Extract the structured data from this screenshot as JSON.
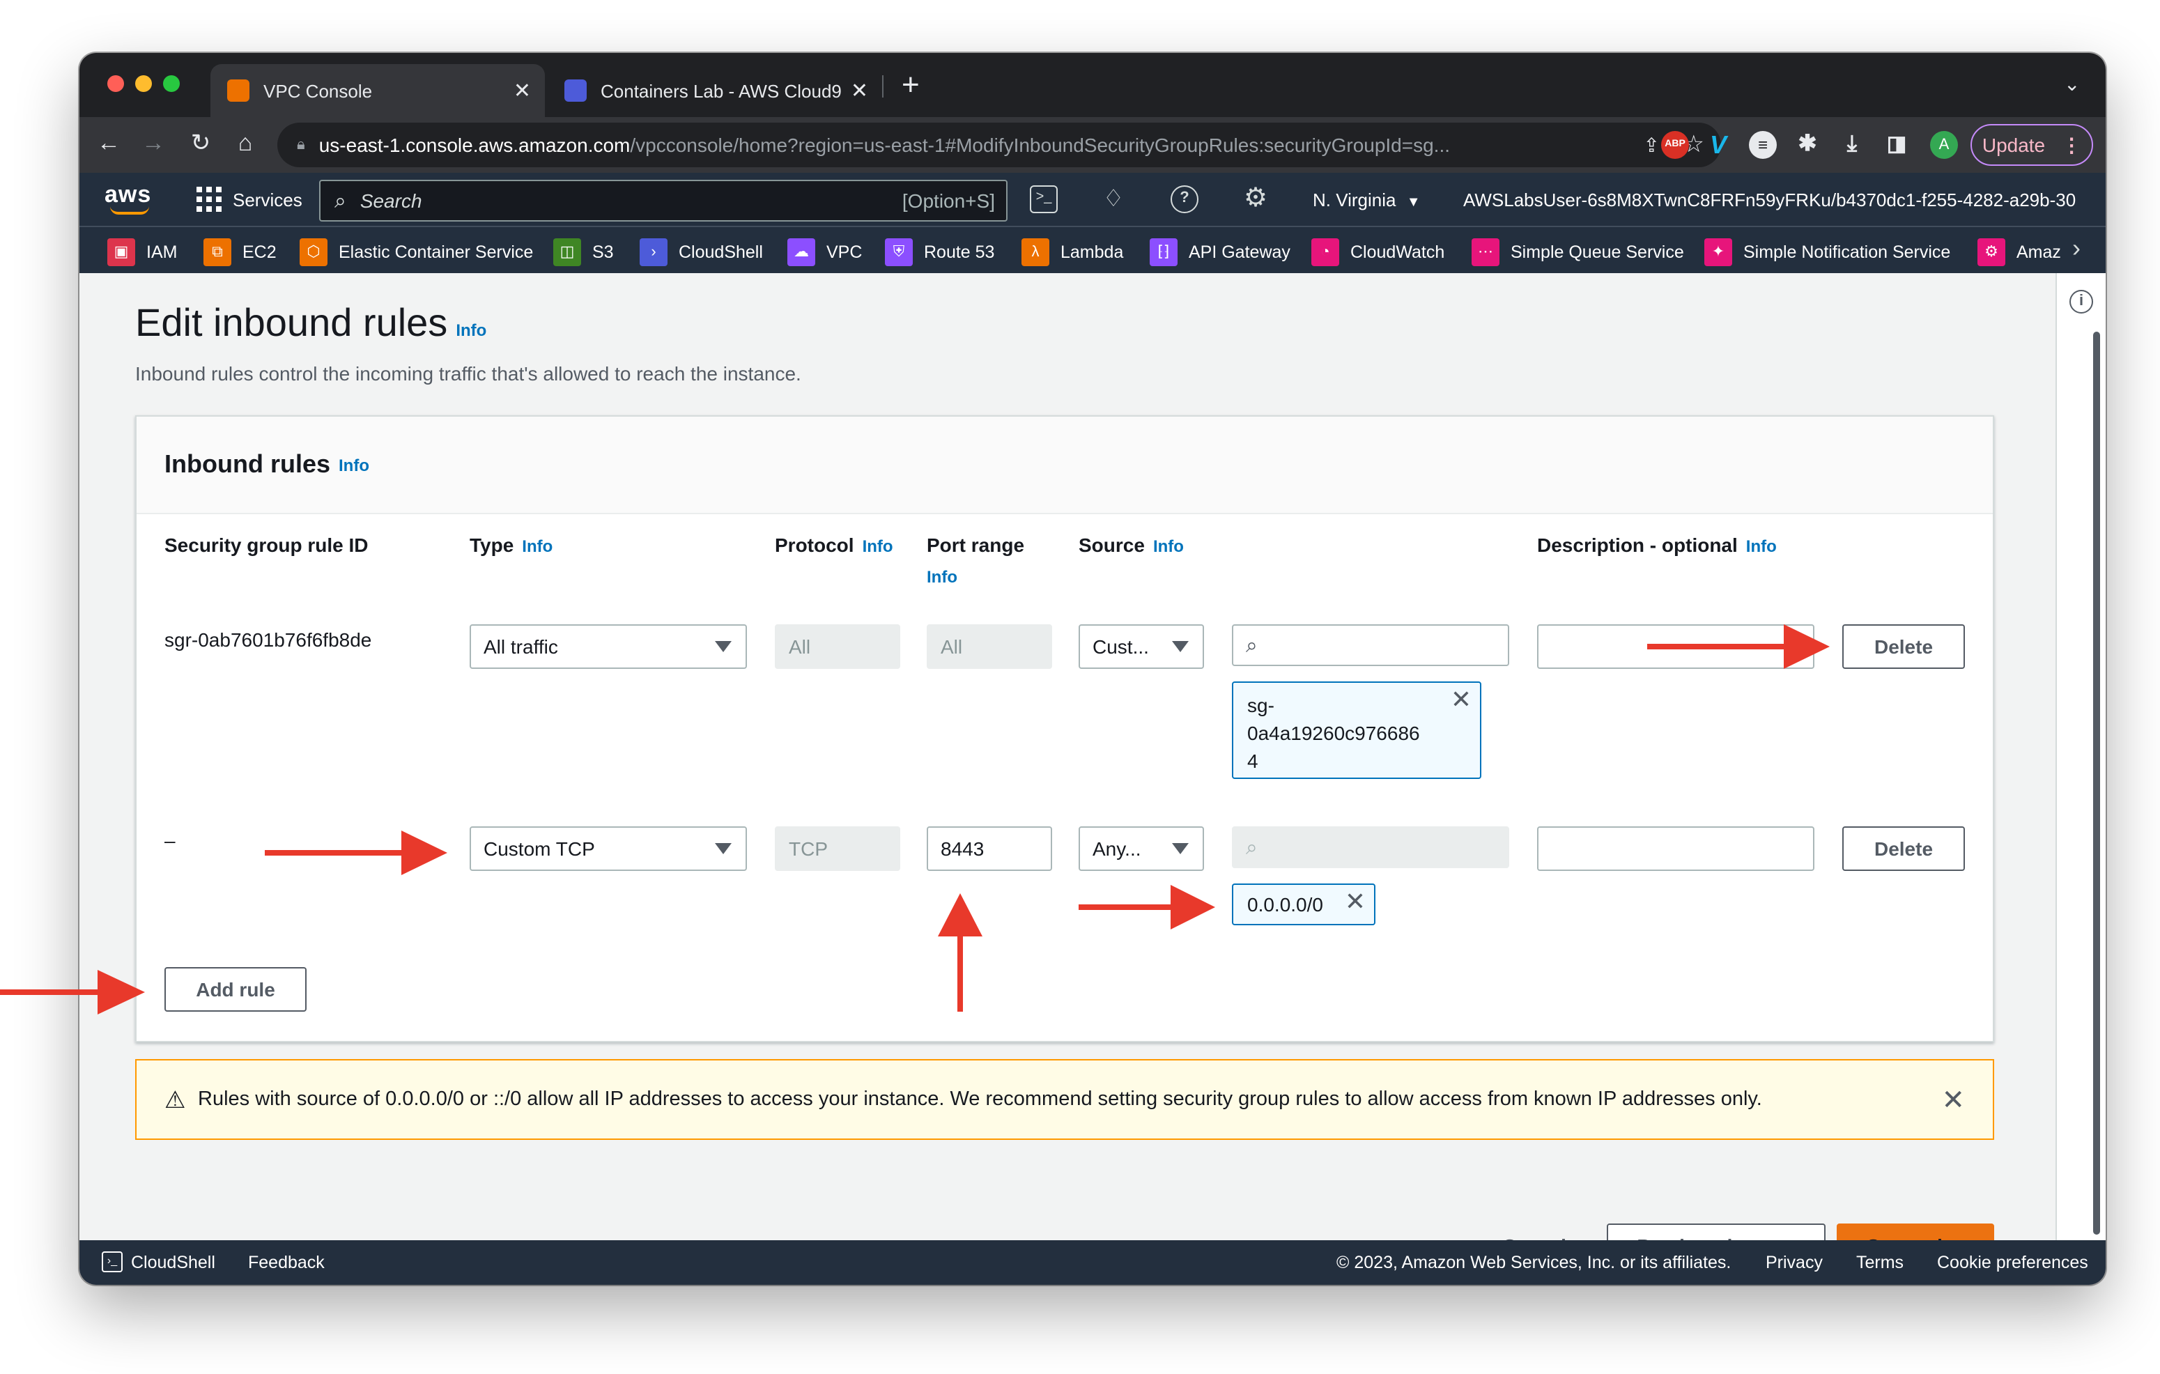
{
  "browser": {
    "tabs": [
      {
        "title": "VPC Console"
      },
      {
        "title": "Containers Lab - AWS Cloud9"
      }
    ],
    "url_host": "us-east-1.console.aws.amazon.com",
    "url_rest": "/vpcconsole/home?region=us-east-1#ModifyInboundSecurityGroupRules:securityGroupId=sg...",
    "update_label": "Update",
    "avatar_letter": "A",
    "abp_label": "ABP"
  },
  "aws_nav": {
    "logo": "aws",
    "services": "Services",
    "search_placeholder": "Search",
    "search_shortcut": "[Option+S]",
    "region": "N. Virginia",
    "account": "AWSLabsUser-6s8M8XTwnC8FRFn59yFRKu/b4370dc1-f255-4282-a29b-30..."
  },
  "favorites": [
    {
      "label": "IAM",
      "color": "#dd344c"
    },
    {
      "label": "EC2",
      "color": "#ed7100"
    },
    {
      "label": "Elastic Container Service",
      "color": "#ed7100"
    },
    {
      "label": "S3",
      "color": "#3f8624"
    },
    {
      "label": "CloudShell",
      "color": "#4d5bd9"
    },
    {
      "label": "VPC",
      "color": "#8c4fff"
    },
    {
      "label": "Route 53",
      "color": "#8c4fff"
    },
    {
      "label": "Lambda",
      "color": "#ed7100"
    },
    {
      "label": "API Gateway",
      "color": "#8c4fff"
    },
    {
      "label": "CloudWatch",
      "color": "#e7157b"
    },
    {
      "label": "Simple Queue Service",
      "color": "#e7157b"
    },
    {
      "label": "Simple Notification Service",
      "color": "#e7157b"
    },
    {
      "label": "Amaz",
      "color": "#e7157b"
    }
  ],
  "page": {
    "title": "Edit inbound rules",
    "info": "Info",
    "subtitle": "Inbound rules control the incoming traffic that's allowed to reach the instance."
  },
  "panel": {
    "title": "Inbound rules",
    "columns": {
      "rule_id": "Security group rule ID",
      "type": "Type",
      "protocol": "Protocol",
      "port_range": "Port range",
      "source": "Source",
      "description": "Description - optional"
    },
    "rows": [
      {
        "rule_id": "sgr-0ab7601b76f6fb8de",
        "type": "All traffic",
        "protocol": "All",
        "port": "All",
        "source": "Cust...",
        "token": "sg-\n0a4a19260c976686\n4",
        "delete": "Delete"
      },
      {
        "rule_id": "–",
        "type": "Custom TCP",
        "protocol": "TCP",
        "port": "8443",
        "source": "Any...",
        "token": "0.0.0.0/0",
        "delete": "Delete"
      }
    ],
    "add_rule": "Add rule"
  },
  "warning": {
    "text": "Rules with source of 0.0.0.0/0 or ::/0 allow all IP addresses to access your instance. We recommend setting security group rules to allow access from known IP addresses only."
  },
  "actions": {
    "cancel": "Cancel",
    "preview": "Preview changes",
    "save": "Save rules"
  },
  "footer": {
    "cloudshell": "CloudShell",
    "feedback": "Feedback",
    "copyright": "© 2023, Amazon Web Services, Inc. or its affiliates.",
    "privacy": "Privacy",
    "terms": "Terms",
    "cookies": "Cookie preferences"
  },
  "colors": {
    "annotation_arrow": "#e8392b",
    "aws_squid_ink": "#232f3e",
    "save_orange": "#ec7211",
    "info_link": "#0073bb"
  }
}
